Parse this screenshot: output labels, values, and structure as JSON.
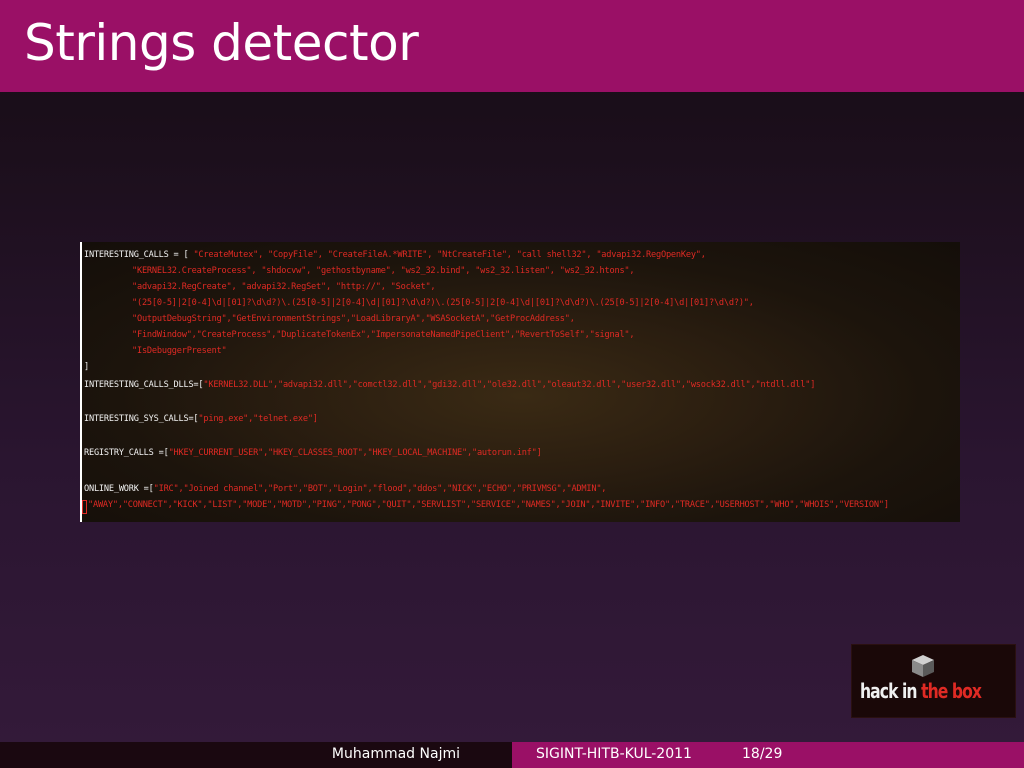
{
  "slide": {
    "title": "Strings detector"
  },
  "code": {
    "lines": [
      {
        "k": "INTERESTING_CALLS = [ ",
        "s": "\"CreateMutex\", \"CopyFile\", \"CreateFileA.*WRITE\", \"NtCreateFile\", \"call shell32\", \"advapi32.RegOpenKey\","
      },
      {
        "k": "",
        "s": "\"KERNEL32.CreateProcess\", \"shdocvw\", \"gethostbyname\", \"ws2_32.bind\", \"ws2_32.listen\", \"ws2_32.htons\","
      },
      {
        "k": "",
        "s": "\"advapi32.RegCreate\", \"advapi32.RegSet\", \"http://\", \"Socket\","
      },
      {
        "k": "",
        "s": "\"(25[0-5]|2[0-4]\\d|[01]?\\d\\d?)\\.(25[0-5]|2[0-4]\\d|[01]?\\d\\d?)\\.(25[0-5]|2[0-4]\\d|[01]?\\d\\d?)\\.(25[0-5]|2[0-4]\\d|[01]?\\d\\d?)\","
      },
      {
        "k": "",
        "s": "\"OutputDebugString\",\"GetEnvironmentStrings\",\"LoadLibraryA\",\"WSASocketA\",\"GetProcAddress\","
      },
      {
        "k": "",
        "s": "\"FindWindow\",\"CreateProcess\",\"DuplicateTokenEx\",\"ImpersonateNamedPipeClient\",\"RevertToSelf\",\"signal\","
      },
      {
        "k": "",
        "s": "\"IsDebuggerPresent\""
      },
      {
        "k": "        ]",
        "s": ""
      },
      {
        "k": "INTERESTING_CALLS_DLLS=[",
        "s": "\"KERNEL32.DLL\",\"advapi32.dll\",\"comctl32.dll\",\"gdi32.dll\",\"ole32.dll\",\"oleaut32.dll\",\"user32.dll\",\"wsock32.dll\",\"ntdll.dll\"]"
      },
      {
        "k": "",
        "s": ""
      },
      {
        "k": "INTERESTING_SYS_CALLS=[",
        "s": "\"ping.exe\",\"telnet.exe\"]"
      },
      {
        "k": "",
        "s": ""
      },
      {
        "k": "REGISTRY_CALLS =[",
        "s": "\"HKEY_CURRENT_USER\",\"HKEY_CLASSES_ROOT\",\"HKEY_LOCAL_MACHINE\",\"autorun.inf\"]"
      },
      {
        "k": "",
        "s": ""
      },
      {
        "k": "ONLINE_WORK =[",
        "s": "\"IRC\",\"Joined channel\",\"Port\",\"BOT\",\"Login\",\"flood\",\"ddos\",\"NICK\",\"ECHO\",\"PRIVMSG\",\"ADMIN\","
      },
      {
        "k": "",
        "s": "\"AWAY\",\"CONNECT\",\"KICK\",\"LIST\",\"MODE\",\"MOTD\",\"PING\",\"PONG\",\"QUIT\",\"SERVLIST\",\"SERVICE\",\"NAMES\",\"JOIN\",\"INVITE\",\"INFO\",\"TRACE\",\"USERHOST\",\"WHO\",\"WHOIS\",\"VERSION\"]"
      }
    ]
  },
  "logo": {
    "part1": "hack in",
    "part2": " the box",
    "accent": "#e02a24"
  },
  "footer": {
    "author": "Muhammad Najmi",
    "event": "SIGINT-HITB-KUL-2011",
    "page": "18/29"
  },
  "colors": {
    "brand": "#9a1066",
    "string": "#e02a24"
  }
}
